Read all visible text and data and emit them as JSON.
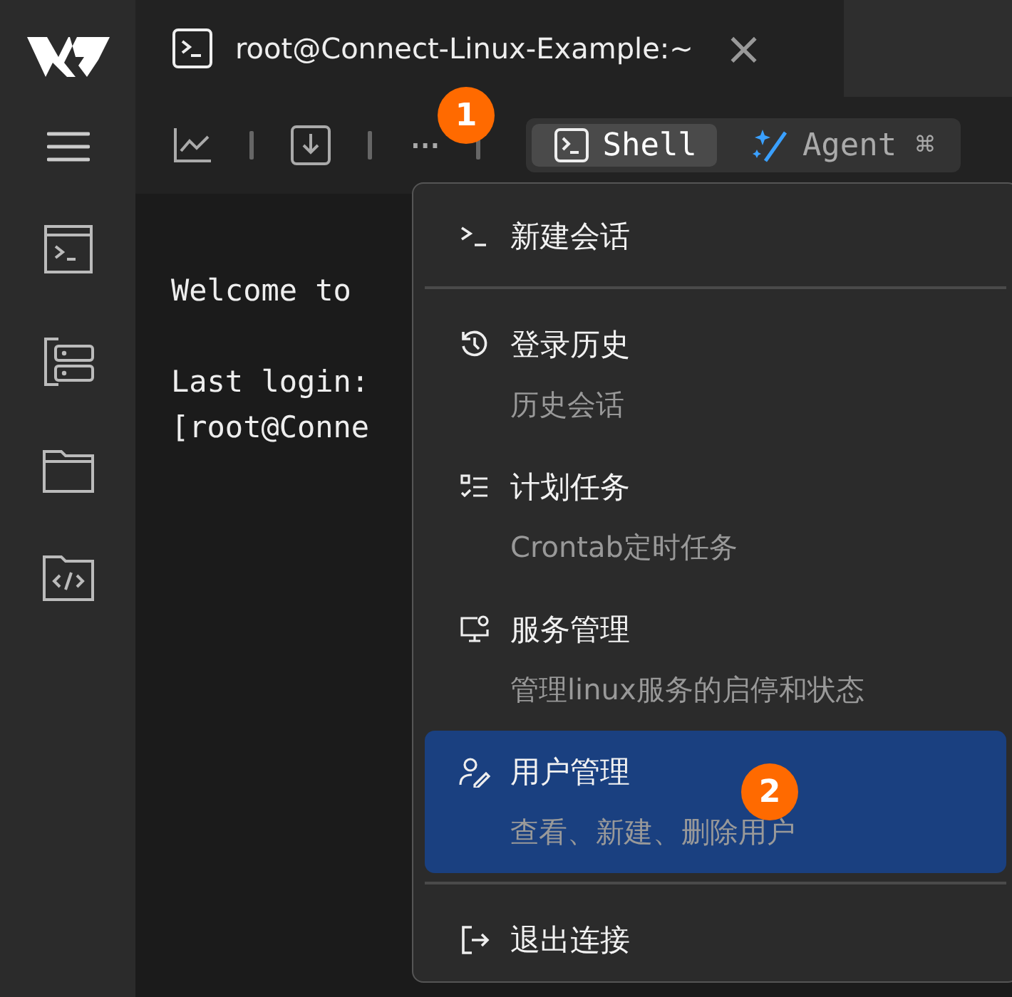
{
  "tab": {
    "title": "root@Connect-Linux-Example:~",
    "close": "×"
  },
  "toolbar": {
    "more": "···",
    "modes": [
      {
        "label": "Shell",
        "selected": true
      },
      {
        "label": "Agent ⌘",
        "selected": false
      }
    ]
  },
  "terminal": {
    "lines": [
      "Welcome to",
      "Last login:",
      "[root@Conne"
    ]
  },
  "menu": {
    "groups": [
      [
        {
          "title": "新建会话",
          "selected": false
        }
      ],
      [
        {
          "title": "登录历史",
          "subtitle": "历史会话",
          "selected": false
        },
        {
          "title": "计划任务",
          "subtitle": "Crontab定时任务",
          "selected": false
        },
        {
          "title": "服务管理",
          "subtitle": "管理linux服务的启停和状态",
          "selected": false
        },
        {
          "title": "用户管理",
          "subtitle": "查看、新建、删除用户",
          "selected": true
        }
      ],
      [
        {
          "title": "退出连接",
          "selected": false
        }
      ]
    ]
  },
  "badges": [
    "1",
    "2"
  ]
}
